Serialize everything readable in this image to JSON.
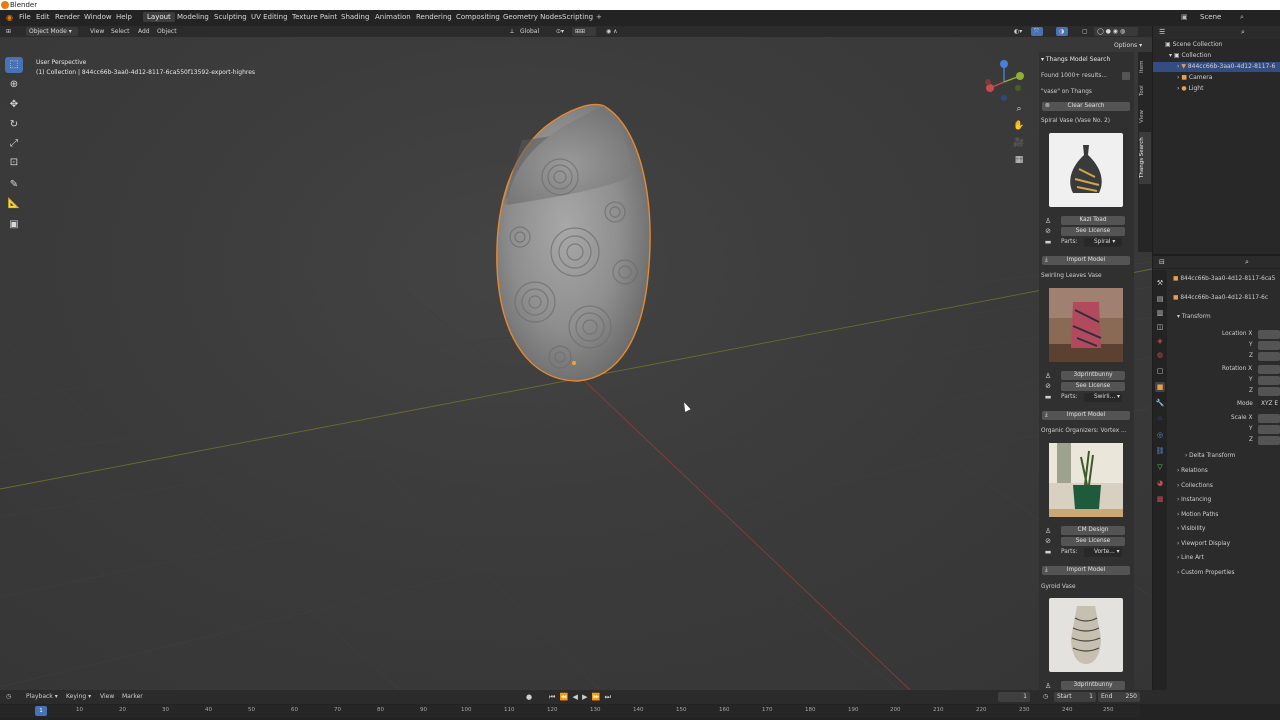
{
  "window": {
    "title": "Blender"
  },
  "menu": {
    "items": [
      "File",
      "Edit",
      "Render",
      "Window",
      "Help"
    ],
    "workspaces": [
      "Layout",
      "Modeling",
      "Sculpting",
      "UV Editing",
      "Texture Paint",
      "Shading",
      "Animation",
      "Rendering",
      "Compositing",
      "Geometry Nodes",
      "Scripting",
      "+"
    ],
    "active_workspace": "Layout",
    "scene": "Scene"
  },
  "viewport_header": {
    "mode": "Object Mode",
    "menus": [
      "View",
      "Select",
      "Add",
      "Object"
    ],
    "orientation": "Global",
    "options": "Options"
  },
  "viewport": {
    "perspective": "User Perspective",
    "collection_info": "(1) Collection | 844cc66b-3aa0-4d12-8117-6ca550f13592-export-highres"
  },
  "sidebar": {
    "tabs": [
      "Item",
      "Tool",
      "View",
      "Thangs Search"
    ],
    "active_tab": "Thangs Search",
    "title": "Thangs Model Search",
    "found": "Found 1000+ results...",
    "query": "\"vase\" on Thangs",
    "clear": "Clear Search",
    "parts_label": "Parts:",
    "results": [
      {
        "title": "Spiral Vase (Vase No. 2)",
        "author": "Kazi Toad",
        "license": "See License",
        "part": "Spiral",
        "import": "Import Model"
      },
      {
        "title": "Swirling Leaves Vase",
        "author": "3dprintbunny",
        "license": "See License",
        "part": "Swirli...",
        "import": "Import Model"
      },
      {
        "title": "Organic Organizers: Vortex ...",
        "author": "CM Design",
        "license": "See License",
        "part": "Vorte...",
        "import": "Import Model"
      },
      {
        "title": "Gyroid Vase",
        "author": "3dprintbunny"
      }
    ]
  },
  "outliner": {
    "root": "Scene Collection",
    "collection": "Collection",
    "items": [
      "844cc66b-3aa0-4d12-8117-6",
      "Camera",
      "Light"
    ]
  },
  "properties": {
    "object_name": "844cc66b-3aa0-4d12-8117-6ca5",
    "data_name": "844cc66b-3aa0-4d12-8117-6c",
    "transform": "Transform",
    "location": [
      "Location X",
      "Y",
      "Z"
    ],
    "rotation": [
      "Rotation X",
      "Y",
      "Z"
    ],
    "mode_label": "Mode",
    "mode_value": "XYZ E",
    "scale": [
      "Scale X",
      "Y",
      "Z"
    ],
    "delta": "Delta Transform",
    "sections": [
      "Relations",
      "Collections",
      "Instancing",
      "Motion Paths",
      "Visibility",
      "Viewport Display",
      "Line Art",
      "Custom Properties"
    ]
  },
  "timeline": {
    "menus": [
      "Playback",
      "Keying",
      "View",
      "Marker"
    ],
    "current_frame": "1",
    "start_label": "Start",
    "start": "1",
    "end_label": "End",
    "end": "250",
    "ticks": [
      "10",
      "20",
      "30",
      "40",
      "50",
      "60",
      "70",
      "80",
      "90",
      "100",
      "110",
      "120",
      "130",
      "140",
      "150",
      "160",
      "170",
      "180",
      "190",
      "200",
      "210",
      "220",
      "230",
      "240",
      "250"
    ]
  }
}
